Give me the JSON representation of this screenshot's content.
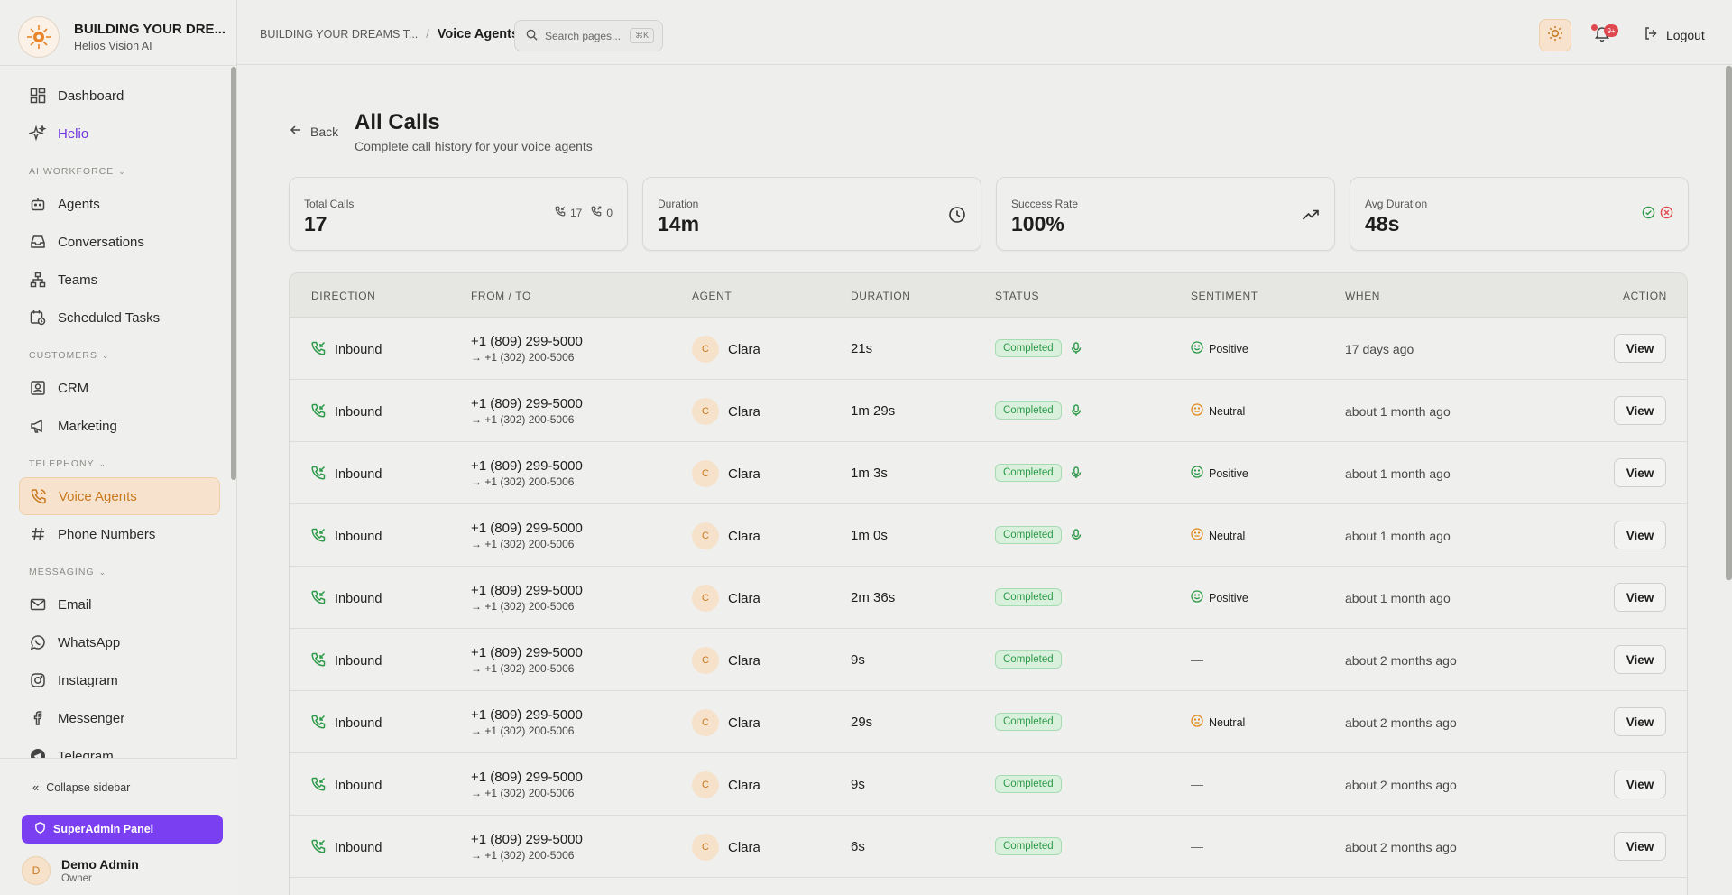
{
  "brand": {
    "name": "BUILDING YOUR DRE...",
    "sub": "Helios Vision AI"
  },
  "sidebar": {
    "top_items": [
      {
        "label": "Dashboard",
        "icon": "dashboard-icon"
      },
      {
        "label": "Helio",
        "icon": "sparkles-icon"
      }
    ],
    "sections": [
      {
        "title": "AI WORKFORCE",
        "items": [
          {
            "label": "Agents",
            "icon": "robot-icon"
          },
          {
            "label": "Conversations",
            "icon": "inbox-icon"
          },
          {
            "label": "Teams",
            "icon": "network-icon"
          },
          {
            "label": "Scheduled Tasks",
            "icon": "calendar-clock-icon"
          }
        ]
      },
      {
        "title": "CUSTOMERS",
        "items": [
          {
            "label": "CRM",
            "icon": "contact-icon"
          },
          {
            "label": "Marketing",
            "icon": "megaphone-icon"
          }
        ]
      },
      {
        "title": "TELEPHONY",
        "items": [
          {
            "label": "Voice Agents",
            "icon": "phone-icon",
            "active": true
          },
          {
            "label": "Phone Numbers",
            "icon": "hash-icon"
          }
        ]
      },
      {
        "title": "MESSAGING",
        "items": [
          {
            "label": "Email",
            "icon": "mail-icon"
          },
          {
            "label": "WhatsApp",
            "icon": "whatsapp-icon"
          },
          {
            "label": "Instagram",
            "icon": "instagram-icon"
          },
          {
            "label": "Messenger",
            "icon": "facebook-icon"
          },
          {
            "label": "Telegram",
            "icon": "telegram-icon"
          }
        ]
      }
    ],
    "collapse_label": "Collapse sidebar",
    "superadmin_label": "SuperAdmin Panel",
    "user": {
      "initial": "D",
      "name": "Demo Admin",
      "role": "Owner"
    }
  },
  "topbar": {
    "breadcrumb_parent": "BUILDING YOUR DREAMS T...",
    "breadcrumb_current": "Voice Agents",
    "search_placeholder": "Search pages...",
    "search_shortcut": "⌘K",
    "notifications_badge": "9+",
    "logout_label": "Logout"
  },
  "page": {
    "back_label": "Back",
    "title": "All Calls",
    "subtitle": "Complete call history for your voice agents"
  },
  "stats": [
    {
      "label": "Total Calls",
      "value": "17",
      "inbound": "17",
      "outbound": "0"
    },
    {
      "label": "Duration",
      "value": "14m"
    },
    {
      "label": "Success Rate",
      "value": "100%"
    },
    {
      "label": "Avg Duration",
      "value": "48s"
    }
  ],
  "table": {
    "headers": [
      "DIRECTION",
      "FROM / TO",
      "AGENT",
      "DURATION",
      "STATUS",
      "SENTIMENT",
      "WHEN",
      "ACTION"
    ],
    "rows": [
      {
        "direction": "Inbound",
        "from": "+1 (809) 299-5000",
        "to": "→ +1 (302) 200-5006",
        "agent_initial": "C",
        "agent": "Clara",
        "duration": "21s",
        "status": "Completed",
        "recording": true,
        "sentiment": "Positive",
        "when": "17 days ago",
        "action": "View"
      },
      {
        "direction": "Inbound",
        "from": "+1 (809) 299-5000",
        "to": "→ +1 (302) 200-5006",
        "agent_initial": "C",
        "agent": "Clara",
        "duration": "1m 29s",
        "status": "Completed",
        "recording": true,
        "sentiment": "Neutral",
        "when": "about 1 month ago",
        "action": "View"
      },
      {
        "direction": "Inbound",
        "from": "+1 (809) 299-5000",
        "to": "→ +1 (302) 200-5006",
        "agent_initial": "C",
        "agent": "Clara",
        "duration": "1m 3s",
        "status": "Completed",
        "recording": true,
        "sentiment": "Positive",
        "when": "about 1 month ago",
        "action": "View"
      },
      {
        "direction": "Inbound",
        "from": "+1 (809) 299-5000",
        "to": "→ +1 (302) 200-5006",
        "agent_initial": "C",
        "agent": "Clara",
        "duration": "1m 0s",
        "status": "Completed",
        "recording": true,
        "sentiment": "Neutral",
        "when": "about 1 month ago",
        "action": "View"
      },
      {
        "direction": "Inbound",
        "from": "+1 (809) 299-5000",
        "to": "→ +1 (302) 200-5006",
        "agent_initial": "C",
        "agent": "Clara",
        "duration": "2m 36s",
        "status": "Completed",
        "recording": false,
        "sentiment": "Positive",
        "when": "about 1 month ago",
        "action": "View"
      },
      {
        "direction": "Inbound",
        "from": "+1 (809) 299-5000",
        "to": "→ +1 (302) 200-5006",
        "agent_initial": "C",
        "agent": "Clara",
        "duration": "9s",
        "status": "Completed",
        "recording": false,
        "sentiment": "—",
        "when": "about 2 months ago",
        "action": "View"
      },
      {
        "direction": "Inbound",
        "from": "+1 (809) 299-5000",
        "to": "→ +1 (302) 200-5006",
        "agent_initial": "C",
        "agent": "Clara",
        "duration": "29s",
        "status": "Completed",
        "recording": false,
        "sentiment": "Neutral",
        "when": "about 2 months ago",
        "action": "View"
      },
      {
        "direction": "Inbound",
        "from": "+1 (809) 299-5000",
        "to": "→ +1 (302) 200-5006",
        "agent_initial": "C",
        "agent": "Clara",
        "duration": "9s",
        "status": "Completed",
        "recording": false,
        "sentiment": "—",
        "when": "about 2 months ago",
        "action": "View"
      },
      {
        "direction": "Inbound",
        "from": "+1 (809) 299-5000",
        "to": "→ +1 (302) 200-5006",
        "agent_initial": "C",
        "agent": "Clara",
        "duration": "6s",
        "status": "Completed",
        "recording": false,
        "sentiment": "—",
        "when": "about 2 months ago",
        "action": "View"
      }
    ]
  },
  "colors": {
    "accent": "#c8781f",
    "helio": "#6f35e0",
    "superadmin": "#7b3ff2",
    "success": "#2c9a48",
    "neutral": "#e08a1a",
    "danger": "#e0484f"
  }
}
